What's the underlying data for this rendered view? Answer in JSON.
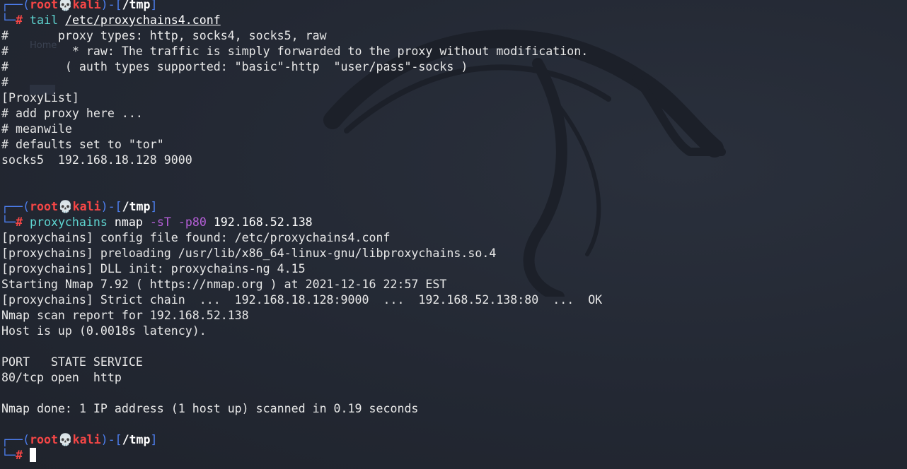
{
  "prompt": {
    "frame_top_left": "┌──(",
    "user": "root",
    "skull": "💀",
    "host": "kali",
    "frame_mid": ")-[",
    "cwd": "/tmp",
    "frame_end": "]",
    "frame_bottom": "└─",
    "symbol": "#"
  },
  "block1": {
    "command": "tail",
    "argument": "/etc/proxychains4.conf",
    "output": [
      "#       proxy types: http, socks4, socks5, raw",
      "#         * raw: The traffic is simply forwarded to the proxy without modification.",
      "#        ( auth types supported: \"basic\"-http  \"user/pass\"-socks )",
      "#",
      "[ProxyList]",
      "# add proxy here ...",
      "# meanwile",
      "# defaults set to \"tor\"",
      "socks5  192.168.18.128 9000"
    ]
  },
  "block2": {
    "command": "proxychains",
    "program": "nmap",
    "option1": "-sT",
    "option2": "-p80",
    "target": "192.168.52.138",
    "output": [
      "[proxychains] config file found: /etc/proxychains4.conf",
      "[proxychains] preloading /usr/lib/x86_64-linux-gnu/libproxychains.so.4",
      "[proxychains] DLL init: proxychains-ng 4.15",
      "Starting Nmap 7.92 ( https://nmap.org ) at 2021-12-16 22:57 EST",
      "[proxychains] Strict chain  ...  192.168.18.128:9000  ...  192.168.52.138:80  ...  OK",
      "Nmap scan report for 192.168.52.138",
      "Host is up (0.0018s latency).",
      "",
      "PORT   STATE SERVICE",
      "80/tcp open  http",
      "",
      "Nmap done: 1 IP address (1 host up) scanned in 0.19 seconds"
    ]
  },
  "background_ghost_text": "Home",
  "colors": {
    "background": "#252a34",
    "prompt_frame": "#4d7ff0",
    "prompt_user": "#f54646",
    "command": "#5ed4d0",
    "option": "#b65fd9",
    "text": "#e8e8e8"
  }
}
